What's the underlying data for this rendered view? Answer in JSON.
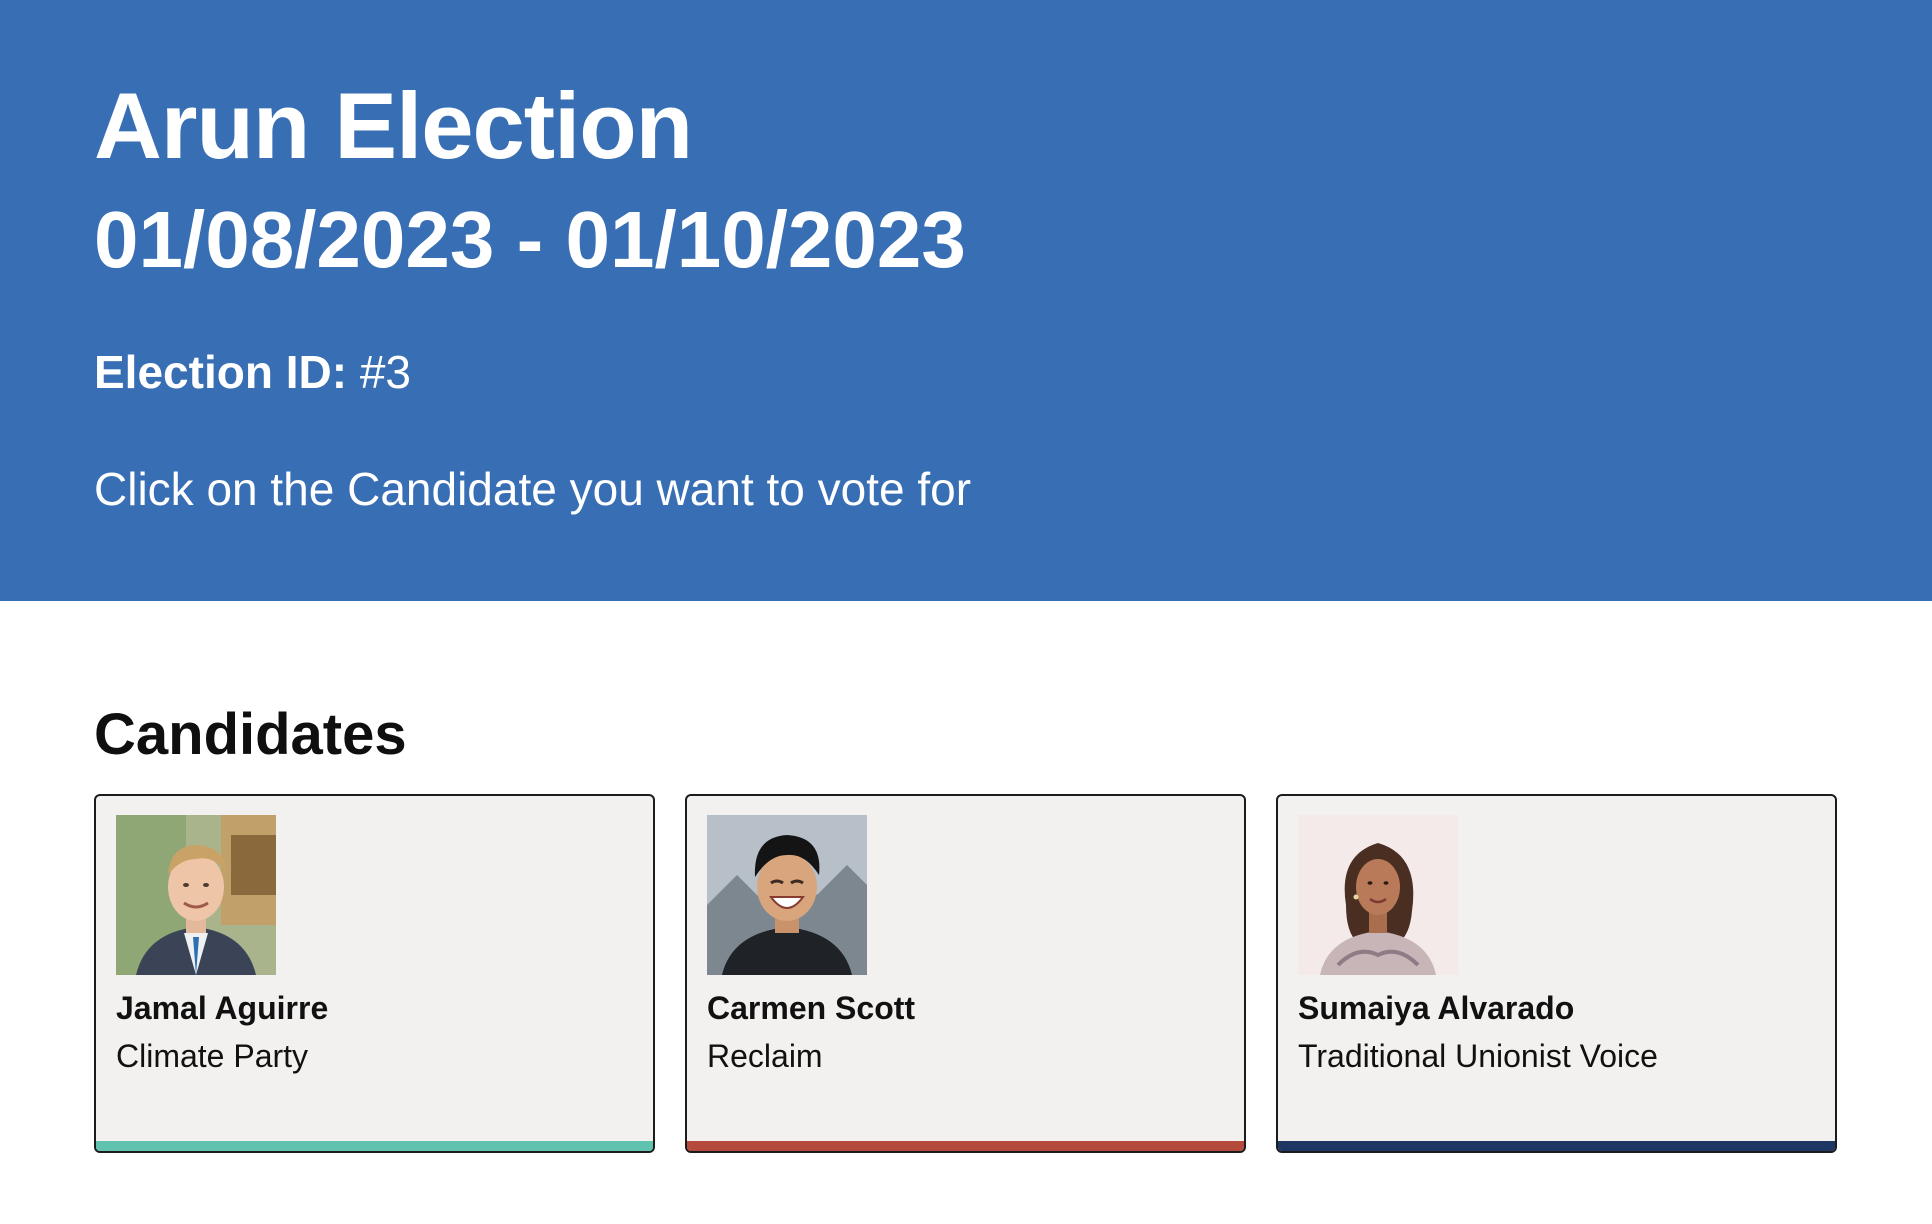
{
  "election": {
    "title": "Arun Election",
    "dates": "01/08/2023 - 01/10/2023",
    "id_label": "Election ID:",
    "id_value": "#3",
    "instruction": "Click on the Candidate you want to vote for"
  },
  "colors": {
    "header_bg": "#386eb4",
    "card_bg": "#f3f1ef"
  },
  "candidates_section": {
    "heading": "Candidates",
    "items": [
      {
        "name": "Jamal Aguirre",
        "party": "Climate Party",
        "party_color": "#5fc3b0",
        "photo_icon": "man-portrait-icon"
      },
      {
        "name": "Carmen Scott",
        "party": "Reclaim",
        "party_color": "#b34a3c",
        "photo_icon": "smiling-man-portrait-icon"
      },
      {
        "name": "Sumaiya Alvarado",
        "party": "Traditional Unionist Voice",
        "party_color": "#1f3563",
        "photo_icon": "woman-portrait-icon"
      }
    ]
  }
}
